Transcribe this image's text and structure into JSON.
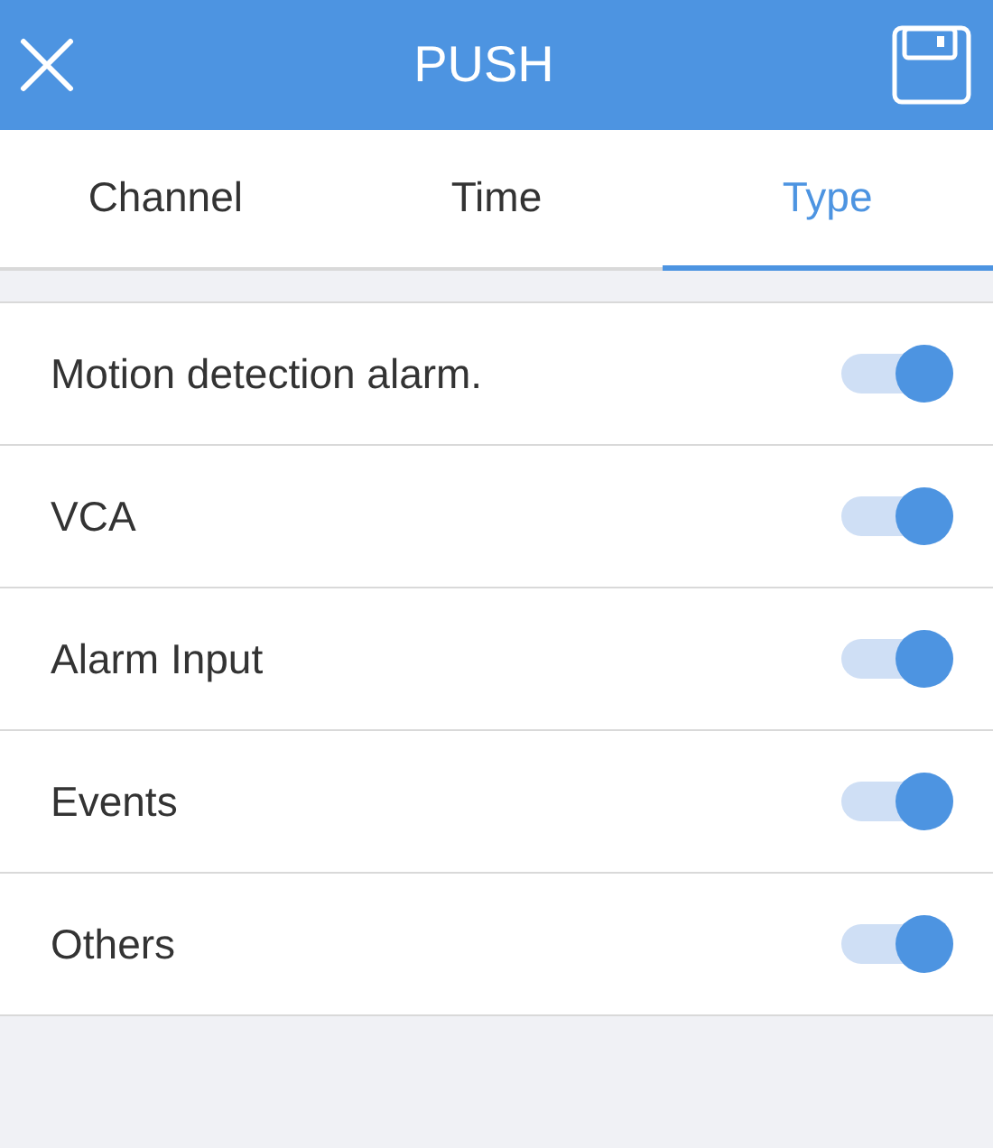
{
  "header": {
    "title": "PUSH"
  },
  "tabs": [
    {
      "label": "Channel",
      "selected": false
    },
    {
      "label": "Time",
      "selected": false
    },
    {
      "label": "Type",
      "selected": true
    }
  ],
  "types": [
    {
      "label": "Motion detection alarm.",
      "on": true
    },
    {
      "label": "VCA",
      "on": true
    },
    {
      "label": "Alarm Input",
      "on": true
    },
    {
      "label": "Events",
      "on": true
    },
    {
      "label": "Others",
      "on": true
    }
  ]
}
